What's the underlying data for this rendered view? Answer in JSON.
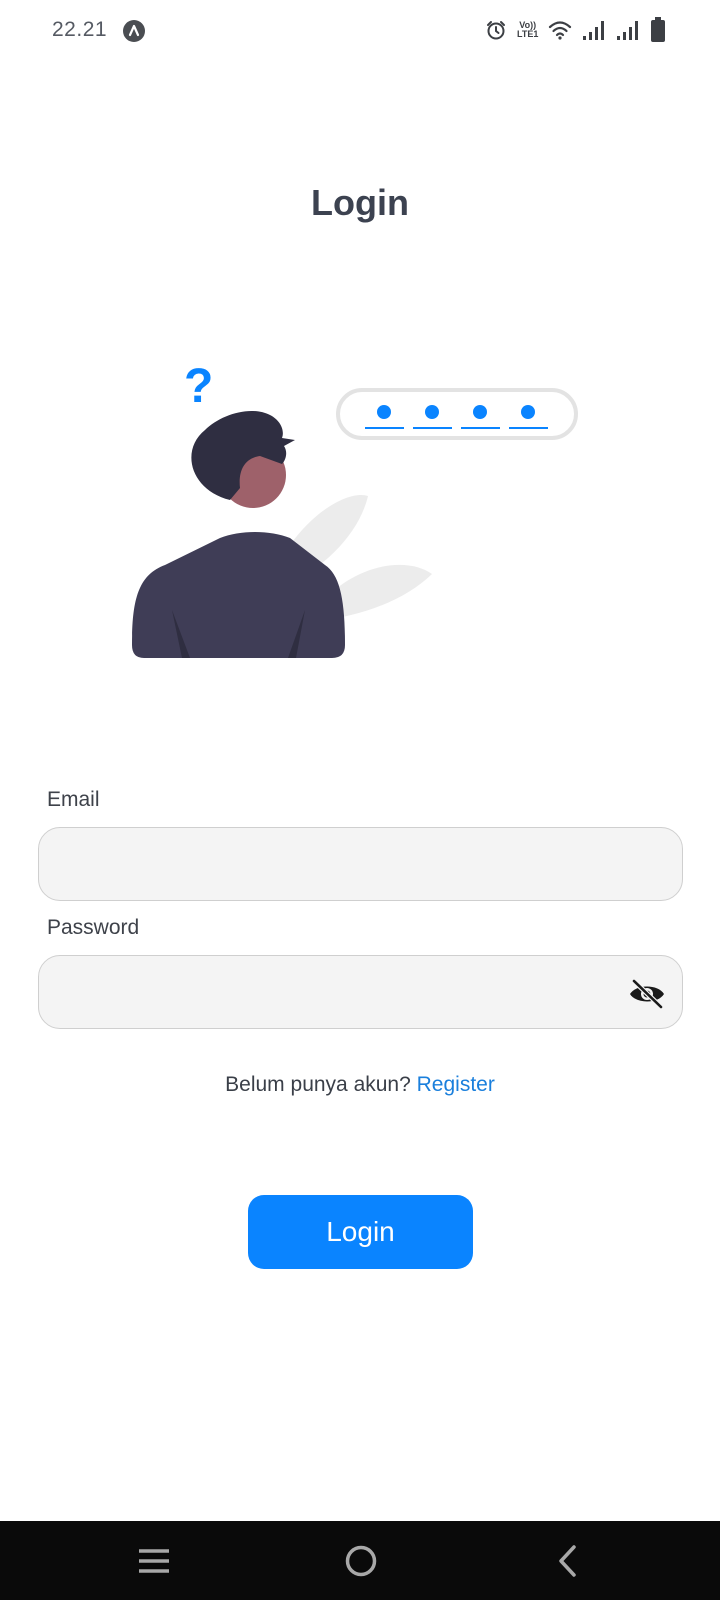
{
  "status_bar": {
    "time": "22.21",
    "lte_top": "Vo))",
    "lte_bottom": "LTE1",
    "icons": [
      "app-indicator-icon",
      "alarm-icon",
      "volte-icon",
      "wifi-icon",
      "signal-icon",
      "signal-icon",
      "battery-icon"
    ]
  },
  "page": {
    "title": "Login"
  },
  "illustration": {
    "question_mark": "?",
    "pin_dots": 4,
    "accent_color": "#0a84ff"
  },
  "form": {
    "email_label": "Email",
    "email_value": "",
    "password_label": "Password",
    "password_value": "",
    "password_toggle_icon": "eye-off-icon"
  },
  "register": {
    "prompt": "Belum punya akun?",
    "link": "Register"
  },
  "login_button": {
    "label": "Login",
    "color": "#0a84ff"
  },
  "nav_bar": {
    "icons": [
      "menu-icon",
      "home-icon",
      "back-icon"
    ]
  }
}
